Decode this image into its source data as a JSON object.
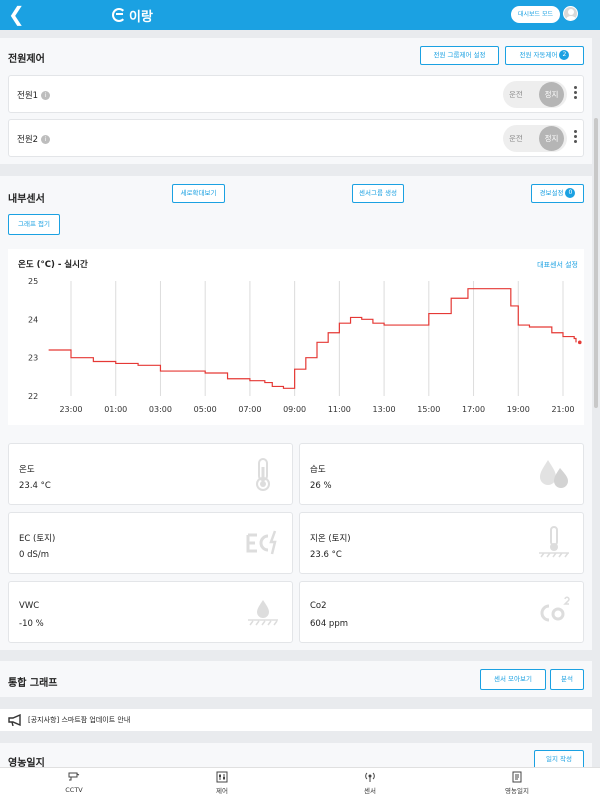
{
  "header": {
    "logo_text": "이랑",
    "dashboard_mode_label": "대시보드 모드"
  },
  "power": {
    "title": "전원제어",
    "group_control_label": "전원 그룹제어 설정",
    "auto_control_label": "전원 자동제어",
    "auto_control_count": "2",
    "rows": [
      {
        "label": "전원1",
        "run_label": "운전",
        "stop_label": "정지"
      },
      {
        "label": "전원2",
        "run_label": "운전",
        "stop_label": "정지"
      }
    ]
  },
  "internal_sensor": {
    "title": "내부센서",
    "vertical_view_label": "세로확대보기",
    "create_group_label": "센서그룹 생성",
    "alarm_settings_label": "경보설정",
    "alarm_count": "0",
    "graph_collapse_label": "그래프 접기"
  },
  "chart": {
    "title": "온도 (°C) - 실시간",
    "rep_sensor_label": "대표센서 설정"
  },
  "chart_data": {
    "type": "line",
    "title": "온도 (°C) - 실시간",
    "x_ticks": [
      "23:00",
      "01:00",
      "03:00",
      "05:00",
      "07:00",
      "09:00",
      "11:00",
      "13:00",
      "15:00",
      "17:00",
      "19:00",
      "21:00"
    ],
    "y_ticks": [
      "25",
      "24",
      "23",
      "22"
    ],
    "ylim": [
      22,
      25
    ],
    "grid": "vertical",
    "line_color": "#e53935",
    "series": [
      {
        "values": [
          {
            "x": "22:00",
            "y": 23.2
          },
          {
            "x": "22:40",
            "y": 23.2
          },
          {
            "x": "23:00",
            "y": 23.0
          },
          {
            "x": "23:30",
            "y": 23.0
          },
          {
            "x": "00:00",
            "y": 22.9
          },
          {
            "x": "01:00",
            "y": 22.85
          },
          {
            "x": "02:00",
            "y": 22.8
          },
          {
            "x": "03:00",
            "y": 22.65
          },
          {
            "x": "05:00",
            "y": 22.6
          },
          {
            "x": "06:00",
            "y": 22.45
          },
          {
            "x": "07:00",
            "y": 22.4
          },
          {
            "x": "07:40",
            "y": 22.35
          },
          {
            "x": "08:00",
            "y": 22.25
          },
          {
            "x": "08:30",
            "y": 22.2
          },
          {
            "x": "09:00",
            "y": 22.7
          },
          {
            "x": "09:30",
            "y": 23.0
          },
          {
            "x": "10:00",
            "y": 23.4
          },
          {
            "x": "10:30",
            "y": 23.65
          },
          {
            "x": "11:00",
            "y": 23.9
          },
          {
            "x": "11:30",
            "y": 24.05
          },
          {
            "x": "12:00",
            "y": 24.0
          },
          {
            "x": "12:30",
            "y": 23.9
          },
          {
            "x": "13:00",
            "y": 23.85
          },
          {
            "x": "14:00",
            "y": 23.85
          },
          {
            "x": "15:00",
            "y": 24.15
          },
          {
            "x": "16:00",
            "y": 24.55
          },
          {
            "x": "16:45",
            "y": 24.8
          },
          {
            "x": "17:30",
            "y": 24.8
          },
          {
            "x": "18:15",
            "y": 24.8
          },
          {
            "x": "18:40",
            "y": 24.35
          },
          {
            "x": "19:00",
            "y": 23.85
          },
          {
            "x": "19:30",
            "y": 23.8
          },
          {
            "x": "20:00",
            "y": 23.8
          },
          {
            "x": "20:30",
            "y": 23.65
          },
          {
            "x": "21:00",
            "y": 23.55
          },
          {
            "x": "21:30",
            "y": 23.5
          },
          {
            "x": "21:45",
            "y": 23.4
          }
        ]
      }
    ]
  },
  "sensors": [
    {
      "label": "온도",
      "value": "23.4 °C",
      "icon": "thermometer-icon"
    },
    {
      "label": "습도",
      "value": "26 %",
      "icon": "humidity-icon"
    },
    {
      "label": "EC (토지)",
      "value": "0 dS/m",
      "icon": "ec-icon"
    },
    {
      "label": "지온 (토지)",
      "value": "23.6 °C",
      "icon": "soil-temperature-icon"
    },
    {
      "label": "VWC",
      "value": "-10 %",
      "icon": "soil-moisture-icon"
    },
    {
      "label": "Co2",
      "value": "604 ppm",
      "icon": "co2-icon"
    }
  ],
  "integrated_graph": {
    "title": "통합 그래프",
    "sensor_view_label": "센서 모아보기",
    "analysis_label": "분석"
  },
  "notice": {
    "text": "[공지사항] 스마트팜 업데이트 안내"
  },
  "farm_log": {
    "title": "영농일지",
    "write_label": "일지 작성"
  },
  "bottom_nav": [
    {
      "label": "CCTV",
      "icon": "cctv-icon"
    },
    {
      "label": "제어",
      "icon": "control-icon"
    },
    {
      "label": "센서",
      "icon": "sensor-icon"
    },
    {
      "label": "영농일지",
      "icon": "farm-log-icon"
    }
  ],
  "colors": {
    "accent": "#1ba1e2",
    "line": "#e53935"
  }
}
